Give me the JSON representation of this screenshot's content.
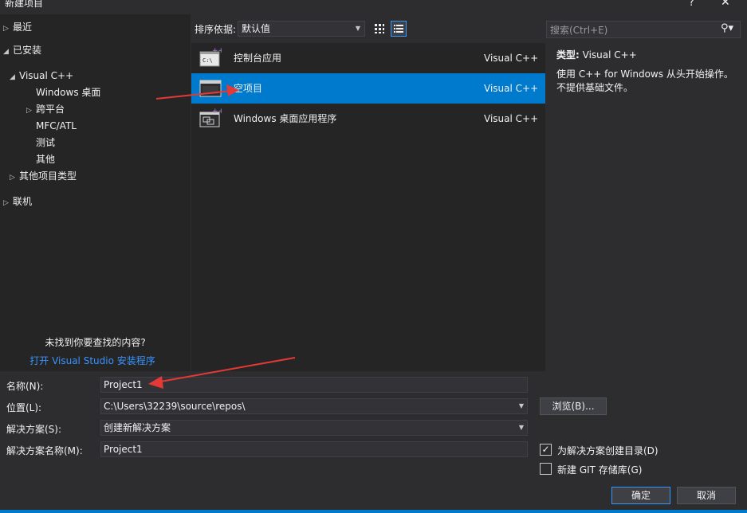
{
  "window": {
    "title": "新建项目",
    "help": "?",
    "close": "✕"
  },
  "tree": {
    "items": [
      {
        "label": "最近",
        "arrow": "▷"
      },
      {
        "label": "已安装",
        "arrow": "◢"
      },
      {
        "label": "Visual C++",
        "arrow": "◢"
      },
      {
        "label": "Windows 桌面",
        "arrow": ""
      },
      {
        "label": "跨平台",
        "arrow": "▷"
      },
      {
        "label": "MFC/ATL",
        "arrow": ""
      },
      {
        "label": "测试",
        "arrow": ""
      },
      {
        "label": "其他",
        "arrow": ""
      },
      {
        "label": "其他项目类型",
        "arrow": "▷"
      },
      {
        "label": "联机",
        "arrow": "▷"
      }
    ],
    "not_found": "未找到你要查找的内容?",
    "open_installer": "打开 Visual Studio 安装程序"
  },
  "sort": {
    "label": "排序依据:",
    "value": "默认值",
    "dropdown_icon": "chevron-down-icon"
  },
  "templates": [
    {
      "name": "控制台应用",
      "lang": "Visual C++",
      "icon": "console-app-icon"
    },
    {
      "name": "空项目",
      "lang": "Visual C++",
      "icon": "empty-project-icon"
    },
    {
      "name": "Windows 桌面应用程序",
      "lang": "Visual C++",
      "icon": "desktop-app-icon"
    }
  ],
  "search": {
    "placeholder": "搜索(Ctrl+E)",
    "icon": "search-icon"
  },
  "description": {
    "type_label": "类型:",
    "type_value": "Visual C++",
    "text": "使用 C++ for Windows 从头开始操作。不提供基础文件。"
  },
  "form": {
    "name_label": "名称(N):",
    "name_value": "Project1",
    "location_label": "位置(L):",
    "location_value": "C:\\Users\\32239\\source\\repos\\",
    "solution_label": "解决方案(S):",
    "solution_value": "创建新解决方案",
    "solution_name_label": "解决方案名称(M):",
    "solution_name_value": "Project1",
    "browse_label": "浏览(B)...",
    "create_dir_label": "为解决方案创建目录(D)",
    "create_dir_checked": "✓",
    "git_label": "新建 GIT 存储库(G)",
    "ok_label": "确定",
    "cancel_label": "取消"
  },
  "colors": {
    "accent": "#007acc",
    "selection": "#007acc",
    "link": "#3794ff",
    "annotation_arrow": "#e53935"
  }
}
